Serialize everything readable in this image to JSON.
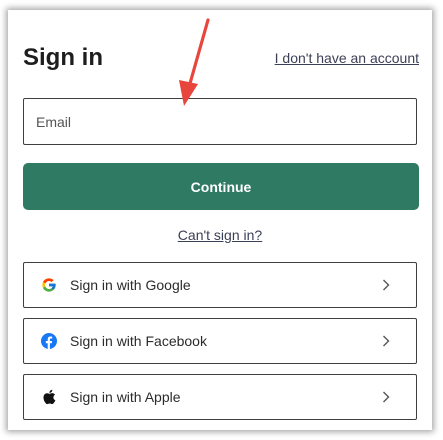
{
  "signin": {
    "title": "Sign in",
    "no_account_link": "I don't have an account",
    "email": {
      "placeholder": "Email",
      "value": ""
    },
    "continue_label": "Continue",
    "cant_sign_in_link": "Can't sign in?",
    "providers": [
      {
        "label": "Sign in with Google",
        "icon": "google-icon"
      },
      {
        "label": "Sign in with Facebook",
        "icon": "facebook-icon"
      },
      {
        "label": "Sign in with Apple",
        "icon": "apple-icon"
      }
    ]
  },
  "colors": {
    "continue_button": "#2f7a63",
    "arrow_annotation": "#e8453c",
    "facebook_blue": "#1877f2"
  }
}
